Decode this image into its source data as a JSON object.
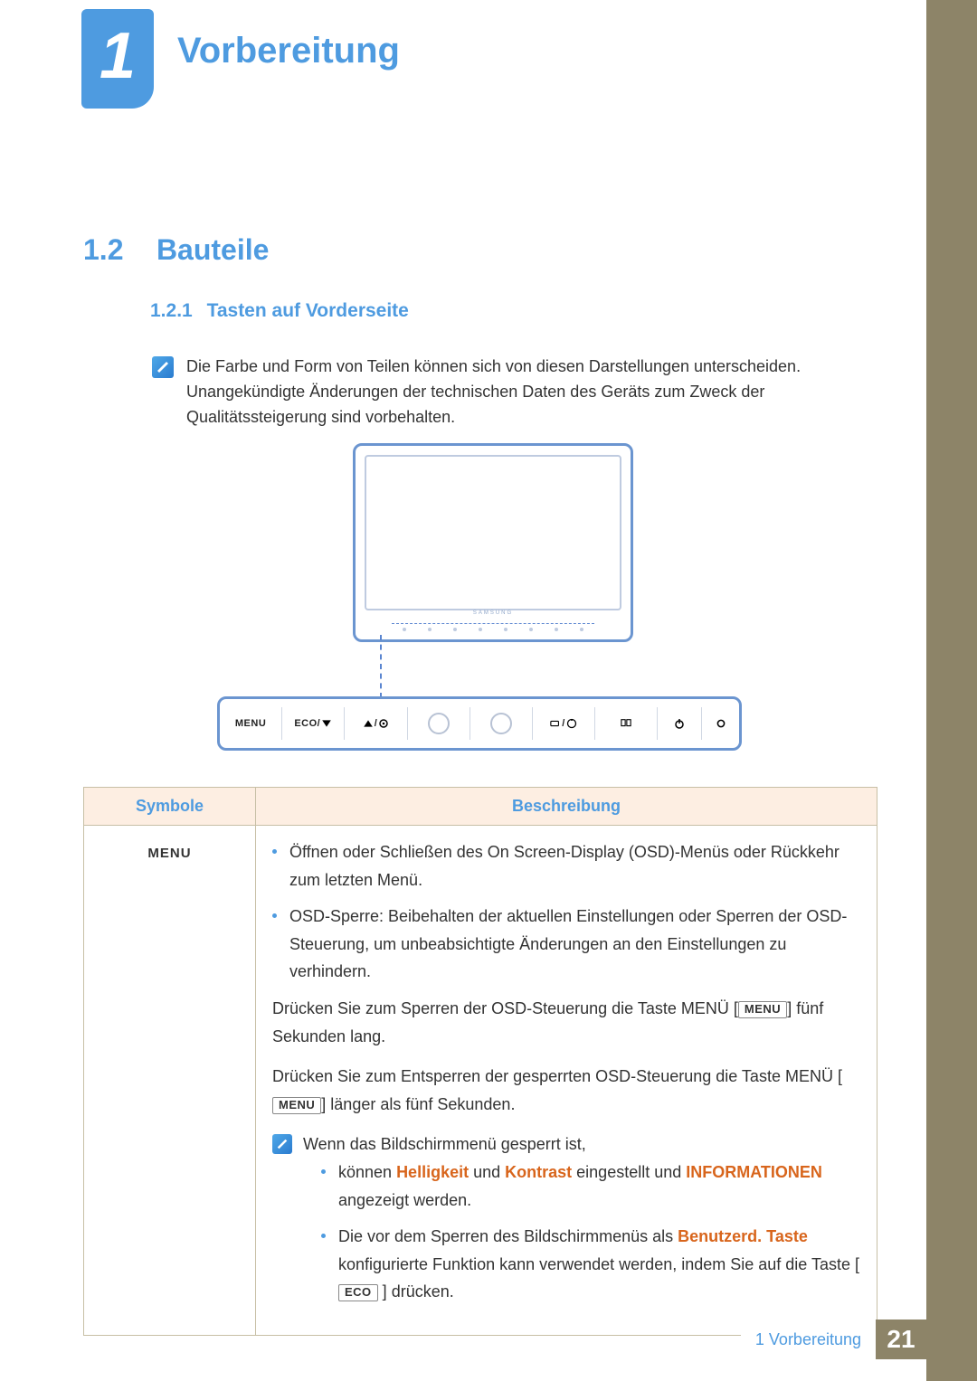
{
  "chapter": {
    "number": "1",
    "title": "Vorbereitung"
  },
  "section": {
    "number": "1.2",
    "title": "Bauteile"
  },
  "subsection": {
    "number": "1.2.1",
    "title": "Tasten auf Vorderseite"
  },
  "note_text": "Die Farbe und Form von Teilen können sich von diesen Darstellungen unterscheiden. Unangekündigte Änderungen der technischen Daten des Geräts zum Zweck der Qualitätssteigerung sind vorbehalten.",
  "diagram": {
    "brand": "SAMSUNG",
    "panel_labels": {
      "menu": "MENU",
      "eco": "ECO/"
    }
  },
  "table": {
    "headers": {
      "symbol": "Symbole",
      "desc": "Beschreibung"
    },
    "row1": {
      "symbol": "MENU",
      "bullet1": "Öffnen oder Schließen des On Screen-Display (OSD)-Menüs oder Rückkehr zum letzten Menü.",
      "bullet2": "OSD-Sperre: Beibehalten der aktuellen Einstellungen oder Sperren der OSD-Steuerung, um unbeabsichtigte Änderungen an den Einstellungen zu verhindern.",
      "para1a": "Drücken Sie zum Sperren der OSD-Steuerung die Taste MENÜ ",
      "para1_key": "MENU",
      "para1b": " fünf Sekunden lang.",
      "para2a": "Drücken Sie zum Entsperren der gesperrten OSD-Steuerung die Taste MENÜ ",
      "para2_key": "MENU",
      "para2b": " länger als fünf Sekunden.",
      "note_intro": "Wenn das Bildschirmmenü gesperrt ist,",
      "note_b1_pre": "können ",
      "note_b1_orange1": "Helligkeit",
      "note_b1_mid": " und ",
      "note_b1_orange2": "Kontrast",
      "note_b1_post": " eingestellt und ",
      "note_b1_orange3": "INFORMATIONEN",
      "note_b1_end": " angezeigt werden.",
      "note_b2_pre": "Die vor dem Sperren des Bildschirmmenüs als ",
      "note_b2_orange": "Benutzerd. Taste",
      "note_b2_mid": " konfigurierte Funktion kann verwendet werden, indem Sie auf die Taste ",
      "note_b2_key": "ECO",
      "note_b2_end": " drücken."
    }
  },
  "footer": {
    "label": "1 Vorbereitung",
    "page": "21"
  }
}
